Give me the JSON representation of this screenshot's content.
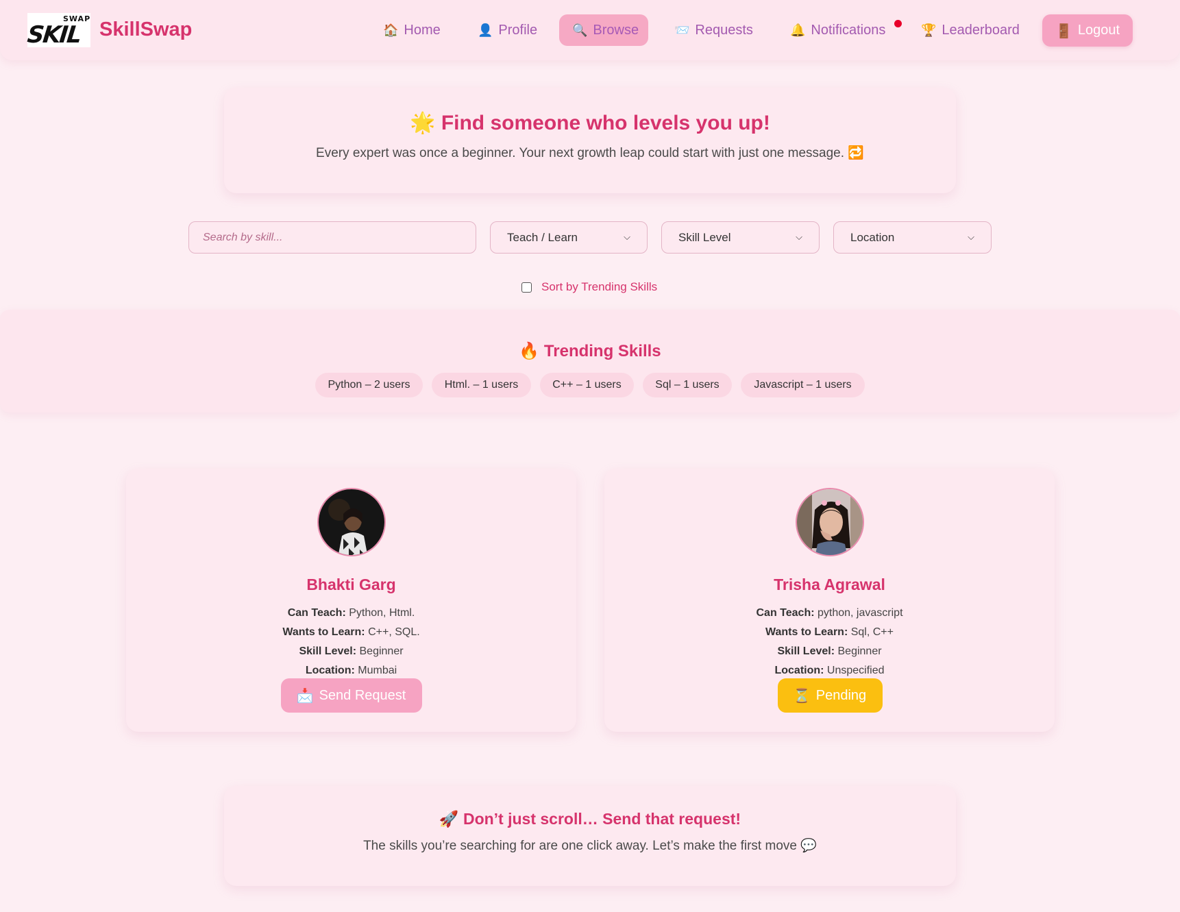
{
  "brand": {
    "logo_text": "SKIL",
    "logo_sup": "SWAP",
    "name": "SkillSwap"
  },
  "nav": {
    "home": {
      "icon": "🏠",
      "label": "Home"
    },
    "profile": {
      "icon": "👤",
      "label": "Profile"
    },
    "browse": {
      "icon": "🔍",
      "label": "Browse"
    },
    "requests": {
      "icon": "📨",
      "label": "Requests"
    },
    "notifications": {
      "icon": "🔔",
      "label": "Notifications"
    },
    "leaderboard": {
      "icon": "🏆",
      "label": "Leaderboard"
    },
    "logout": {
      "icon": "🚪",
      "label": "Logout"
    }
  },
  "hero": {
    "icon": "🌟",
    "title": "Find someone who levels you up!",
    "subtitle": "Every expert was once a beginner. Your next growth leap could start with just one message.",
    "subtitle_icon": "🔁"
  },
  "filters": {
    "search_placeholder": "Search by skill...",
    "teach_learn": "Teach / Learn",
    "skill_level": "Skill Level",
    "location": "Location",
    "sort_trending": "Sort by Trending Skills",
    "sort_trending_checked": false
  },
  "trending": {
    "icon": "🔥",
    "title": "Trending Skills",
    "pills": [
      "Python – 2 users",
      "Html. – 1 users",
      "C++ – 1 users",
      "Sql – 1 users",
      "Javascript – 1 users"
    ]
  },
  "labels": {
    "can_teach": "Can Teach:",
    "wants_to_learn": "Wants to Learn:",
    "skill_level": "Skill Level:",
    "location": "Location:"
  },
  "users": [
    {
      "name": "Bhakti Garg",
      "can_teach": "Python, Html.",
      "wants_to_learn": "C++, SQL.",
      "skill_level": "Beginner",
      "location": "Mumbai",
      "button_icon": "📩",
      "button_label": "Send Request"
    },
    {
      "name": "Trisha Agrawal",
      "can_teach": "python, javascript",
      "wants_to_learn": "Sql, C++",
      "skill_level": "Beginner",
      "location": "Unspecified",
      "button_icon": "⏳",
      "button_label": "Pending"
    }
  ],
  "cta": {
    "icon": "🚀",
    "title": "Don’t just scroll… Send that request!",
    "subtitle": "The skills you’re searching for are one click away. Let’s make the first move",
    "subtitle_icon": "💬"
  },
  "colors": {
    "accent": "#d6336c",
    "nav_text": "#a35ab0",
    "button_pink": "#f6a3c2",
    "pending_yellow": "#fbbf10",
    "background": "#fdeef3"
  }
}
